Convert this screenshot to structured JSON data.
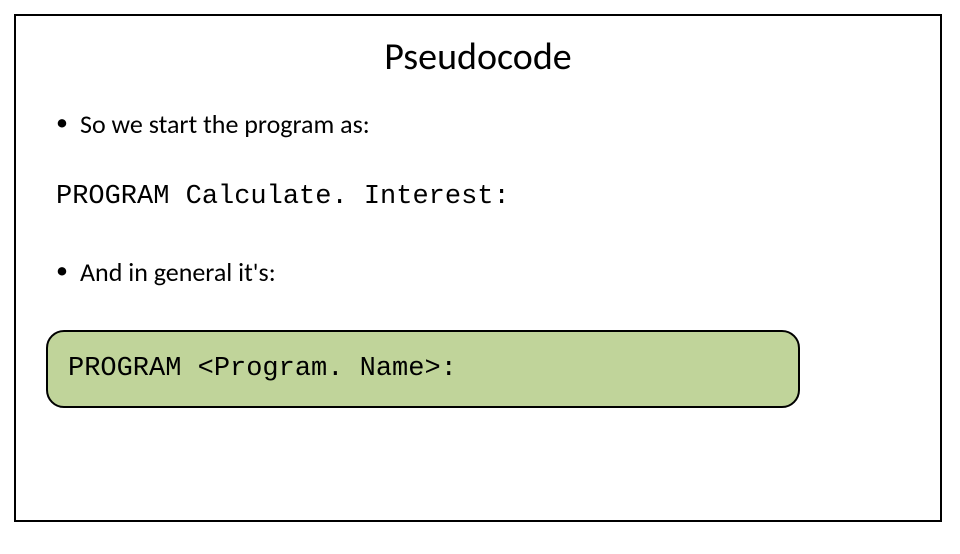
{
  "title": "Pseudocode",
  "bullet1": "So we start the program as:",
  "code1": "PROGRAM Calculate. Interest:",
  "bullet2": "And in general it's:",
  "code2": "PROGRAM <Program. Name>:"
}
